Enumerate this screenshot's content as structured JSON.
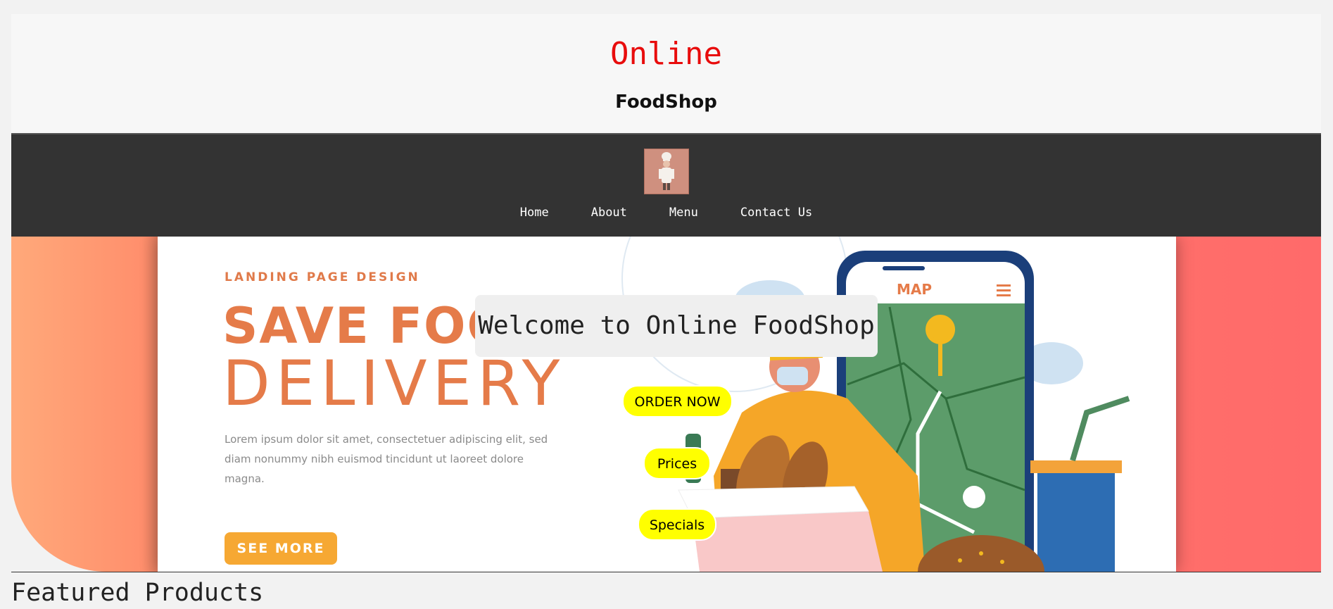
{
  "brand": {
    "title": "Online",
    "subtitle": "FoodShop",
    "title_color": "#e80c0c"
  },
  "nav": {
    "logo_icon": "chef-logo-icon",
    "links": [
      "Home",
      "About",
      "Menu",
      "Contact Us"
    ]
  },
  "hero": {
    "banner": {
      "small": "LANDING PAGE DESIGN",
      "headline1": "SAVE FOOD",
      "headline2": "DELIVERY",
      "lorem": "Lorem ipsum dolor sit amet, consectetuer adipiscing elit, sed diam nonummy nibh euismod tincidunt ut laoreet dolore magna.",
      "see_more": "SEE MORE",
      "map_label": "MAP"
    },
    "welcome": "Welcome to Online FoodShop",
    "buttons": {
      "order": "ORDER NOW",
      "prices": "Prices",
      "specials": "Specials"
    },
    "accent_color": "#ffff00"
  },
  "featured": {
    "heading": "Featured Products"
  }
}
